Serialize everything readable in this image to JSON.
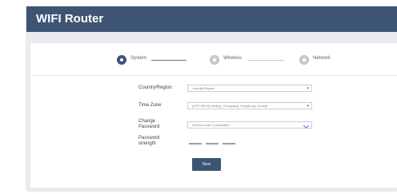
{
  "app": {
    "title": "WIFI Router"
  },
  "steps": [
    {
      "label": "System",
      "active": true
    },
    {
      "label": "Wireless",
      "active": false
    },
    {
      "label": "Network",
      "active": false
    }
  ],
  "form": {
    "country": {
      "label": "Country/Region",
      "value": "Country/Region"
    },
    "timezone": {
      "label": "Time Zone",
      "value": "(UTC+08:00) Beijing, Chongqing, HongKong, Urumqi"
    },
    "password": {
      "label_line1": "Change",
      "label_line2": "Password",
      "placeholder": "Not less than 6 characters"
    },
    "strength": {
      "label_line1": "Password",
      "label_line2": "strength"
    }
  },
  "buttons": {
    "next": "Next"
  },
  "colors": {
    "header": "#3e5474",
    "accent": "#3e5474",
    "background": "#e9ebee"
  },
  "icons": [
    "step-system-icon",
    "step-wireless-icon",
    "step-network-icon",
    "dropdown-arrow-icon",
    "chevron-down-icon"
  ]
}
